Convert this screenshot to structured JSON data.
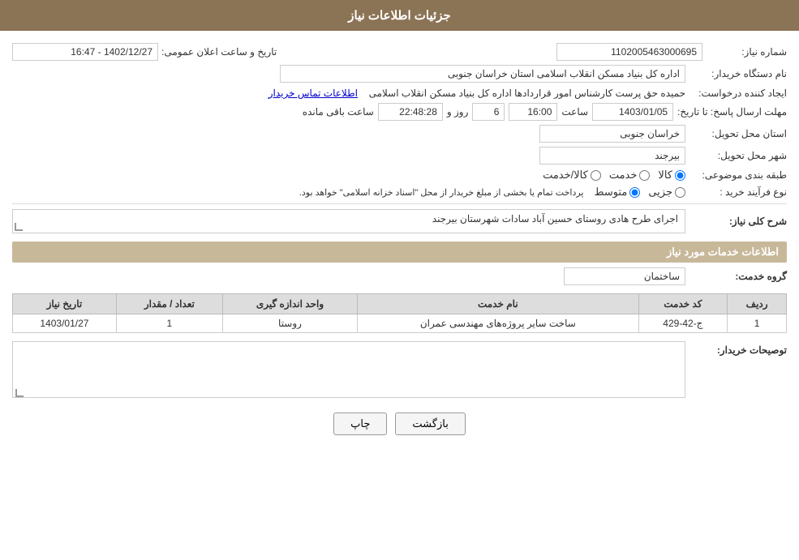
{
  "header": {
    "title": "جزئیات اطلاعات نیاز"
  },
  "fields": {
    "shomara_niaz_label": "شماره نیاز:",
    "shomara_niaz_value": "1102005463000695",
    "tarikh_label": "تاریخ و ساعت اعلان عمومی:",
    "tarikh_value": "1402/12/27 - 16:47",
    "namdastgah_label": "نام دستگاه خریدار:",
    "namdastgah_value": "اداره کل بنیاد مسکن انقلاب اسلامی استان خراسان جنوبی",
    "ijad_label": "ایجاد کننده درخواست:",
    "ijad_value": "حمیده حق پرست کارشناس امور قراردادها اداره کل بنیاد مسکن انقلاب اسلامی",
    "ijad_link": "اطلاعات تماس خریدار",
    "mohlat_label": "مهلت ارسال پاسخ: تا تاریخ:",
    "mohlat_date": "1403/01/05",
    "mohlat_saat_label": "ساعت",
    "mohlat_saat": "16:00",
    "mohlat_rooz_label": "روز و",
    "mohlat_rooz": "6",
    "mohlat_baqi_label": "ساعت باقی مانده",
    "mohlat_countdown": "22:48:28",
    "ostan_label": "استان محل تحویل:",
    "ostan_value": "خراسان جنوبی",
    "shahr_label": "شهر محل تحویل:",
    "shahr_value": "بیرجند",
    "tabaqe_label": "طبقه بندی موضوعی:",
    "tabaqe_options": [
      "کالا",
      "خدمت",
      "کالا/خدمت"
    ],
    "tabaqe_selected": "کالا",
    "noefrayand_label": "نوع فرآیند خرید :",
    "noefrayand_options": [
      "جزیی",
      "متوسط"
    ],
    "noefrayand_note": "پرداخت تمام یا بخشی از مبلغ خریدار از محل \"اسناد خزانه اسلامی\" خواهد بود.",
    "sharh_label": "شرح کلی نیاز:",
    "sharh_value": "اجرای طرح هادی روستای حسین آباد سادات شهرستان بیرجند",
    "khadamat_label": "اطلاعات خدمات مورد نیاز",
    "gorohe_khadamat_label": "گروه خدمت:",
    "gorohe_khadamat_value": "ساختمان",
    "table": {
      "headers": [
        "ردیف",
        "کد خدمت",
        "نام خدمت",
        "واحد اندازه گیری",
        "تعداد / مقدار",
        "تاریخ نیاز"
      ],
      "rows": [
        {
          "radif": "1",
          "kod": "ج-42-429",
          "name": "ساخت سایر پروژه‌های مهندسی عمران",
          "vahed": "روستا",
          "tedad": "1",
          "tarikh": "1403/01/27"
        }
      ]
    },
    "tosif_label": "توصیحات خریدار:",
    "tosif_value": ""
  },
  "buttons": {
    "print": "چاپ",
    "back": "بازگشت"
  }
}
